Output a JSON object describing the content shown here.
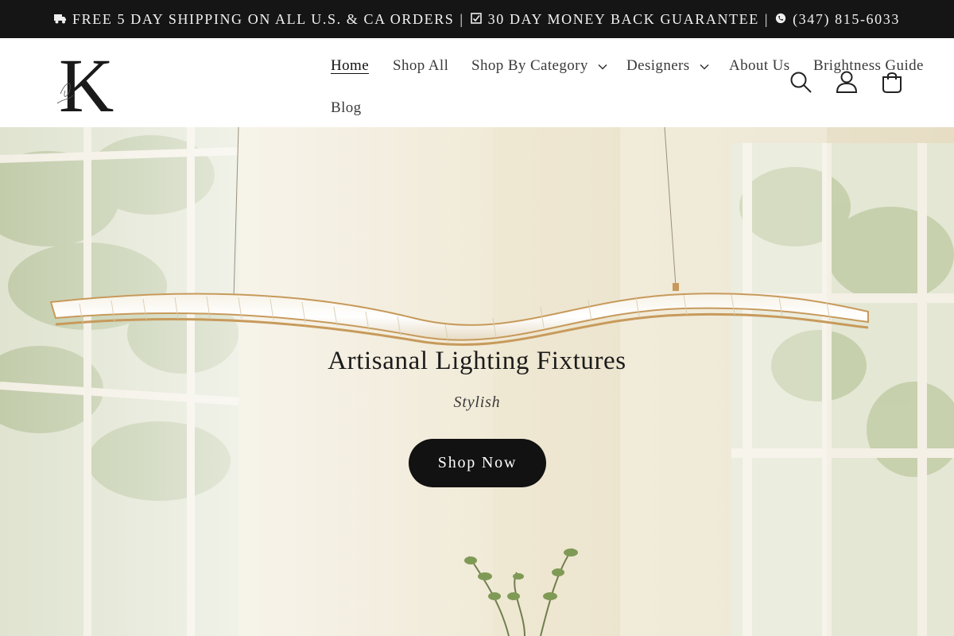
{
  "announcement": {
    "shipping": "FREE 5 DAY SHIPPING ON ALL U.S. & CA ORDERS",
    "guarantee": "30 DAY MONEY BACK GUARANTEE",
    "phone": "(347) 815-6033",
    "separator": "|"
  },
  "logo": {
    "letter": "K"
  },
  "nav": {
    "home": "Home",
    "shop_all": "Shop All",
    "shop_by_category": "Shop By Category",
    "designers": "Designers",
    "about_us": "About Us",
    "brightness_guide": "Brightness Guide",
    "blog": "Blog"
  },
  "icons": {
    "search": "search-icon",
    "account": "account-icon",
    "cart": "cart-icon",
    "truck": "truck-icon",
    "check": "checkbox-icon",
    "phone": "phone-icon"
  },
  "hero": {
    "title": "Artisanal Lighting Fixtures",
    "subtitle": "Stylish",
    "button": "Shop Now"
  },
  "colors": {
    "bar": "#151515",
    "button": "#121212",
    "gold": "#c79a5b"
  }
}
